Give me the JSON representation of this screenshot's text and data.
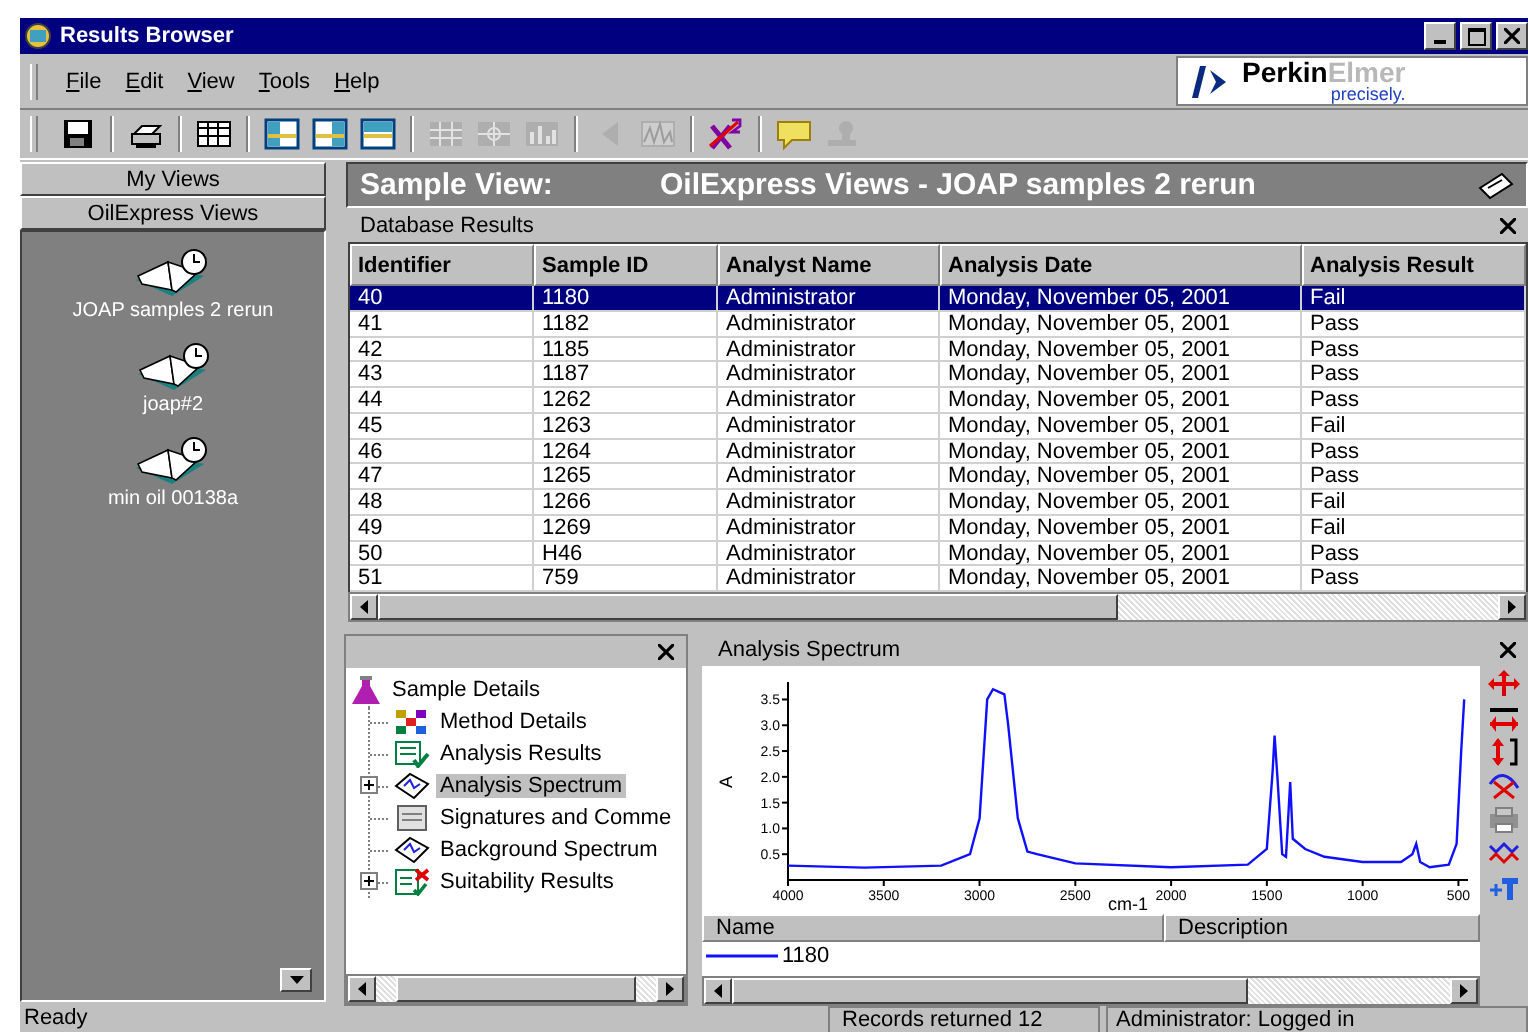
{
  "window": {
    "title": "Results Browser"
  },
  "menu": [
    "File",
    "Edit",
    "View",
    "Tools",
    "Help"
  ],
  "logo": {
    "brand_1": "Perkin",
    "brand_2": "Elmer",
    "tagline": "precisely."
  },
  "toolbar": [
    [
      {
        "kind": "save",
        "disabled": false
      }
    ],
    [
      {
        "kind": "print",
        "disabled": false
      }
    ],
    [
      {
        "kind": "table",
        "disabled": false
      }
    ],
    [
      {
        "kind": "layout-left",
        "disabled": false
      },
      {
        "kind": "layout-right",
        "disabled": false
      },
      {
        "kind": "layout-top",
        "disabled": false
      }
    ],
    [
      {
        "kind": "grid",
        "disabled": true
      },
      {
        "kind": "crosshair",
        "disabled": true
      },
      {
        "kind": "bars",
        "disabled": true
      }
    ],
    [
      {
        "kind": "back",
        "disabled": true
      },
      {
        "kind": "spectrum",
        "disabled": true
      }
    ],
    [
      {
        "kind": "x-squared",
        "disabled": false
      }
    ],
    [
      {
        "kind": "note",
        "disabled": false
      },
      {
        "kind": "stamp",
        "disabled": true
      }
    ]
  ],
  "views": {
    "groups": [
      "My Views",
      "OilExpress Views"
    ],
    "items": [
      "JOAP samples 2 rerun",
      "joap#2",
      "min oil 00138a"
    ]
  },
  "sample_view": {
    "label": "Sample View:",
    "name": "OilExpress Views - JOAP samples 2 rerun"
  },
  "database_results": {
    "title": "Database Results",
    "columns": [
      "Identifier",
      "Sample ID",
      "Analyst Name",
      "Analysis Date",
      "Analysis Result"
    ],
    "rows": [
      {
        "cells": [
          "40",
          "1180",
          "Administrator",
          "Monday, November 05, 2001",
          "Fail"
        ],
        "selected": true
      },
      {
        "cells": [
          "41",
          "1182",
          "Administrator",
          "Monday, November 05, 2001",
          "Pass"
        ],
        "selected": false
      },
      {
        "cells": [
          "42",
          "1185",
          "Administrator",
          "Monday, November 05, 2001",
          "Pass"
        ],
        "selected": false
      },
      {
        "cells": [
          "43",
          "1187",
          "Administrator",
          "Monday, November 05, 2001",
          "Pass"
        ],
        "selected": false
      },
      {
        "cells": [
          "44",
          "1262",
          "Administrator",
          "Monday, November 05, 2001",
          "Pass"
        ],
        "selected": false
      },
      {
        "cells": [
          "45",
          "1263",
          "Administrator",
          "Monday, November 05, 2001",
          "Fail"
        ],
        "selected": false
      },
      {
        "cells": [
          "46",
          "1264",
          "Administrator",
          "Monday, November 05, 2001",
          "Pass"
        ],
        "selected": false
      },
      {
        "cells": [
          "47",
          "1265",
          "Administrator",
          "Monday, November 05, 2001",
          "Pass"
        ],
        "selected": false
      },
      {
        "cells": [
          "48",
          "1266",
          "Administrator",
          "Monday, November 05, 2001",
          "Fail"
        ],
        "selected": false
      },
      {
        "cells": [
          "49",
          "1269",
          "Administrator",
          "Monday, November 05, 2001",
          "Fail"
        ],
        "selected": false
      },
      {
        "cells": [
          "50",
          "H46",
          "Administrator",
          "Monday, November 05, 2001",
          "Pass"
        ],
        "selected": false
      },
      {
        "cells": [
          "51",
          "759",
          "Administrator",
          "Monday, November 05, 2001",
          "Pass"
        ],
        "selected": false
      }
    ]
  },
  "details": {
    "root": "Sample Details",
    "children": [
      {
        "label": "Method Details",
        "kind": "method",
        "expandable": false,
        "selected": false
      },
      {
        "label": "Analysis Results",
        "kind": "results",
        "expandable": false,
        "selected": false
      },
      {
        "label": "Analysis Spectrum",
        "kind": "spectrum",
        "expandable": true,
        "selected": true
      },
      {
        "label": "Signatures and Comme",
        "kind": "signatures",
        "expandable": false,
        "selected": false
      },
      {
        "label": "Background Spectrum",
        "kind": "spectrum",
        "expandable": false,
        "selected": false
      },
      {
        "label": "Suitability Results",
        "kind": "suitability",
        "expandable": true,
        "selected": false
      }
    ]
  },
  "spectrum": {
    "title": "Analysis Spectrum",
    "chart_data": {
      "type": "line",
      "xlabel": "cm-1",
      "ylabel": "A",
      "xlim": [
        4000,
        450
      ],
      "ylim": [
        0,
        3.8
      ],
      "xticks": [
        4000,
        3500,
        3000,
        2500,
        2000,
        1500,
        1000,
        500
      ],
      "yticks": [
        {
          "value": 0.5,
          "label": "0.5"
        },
        {
          "value": 1,
          "label": "1.0"
        },
        {
          "value": 1.5,
          "label": "1.5"
        },
        {
          "value": 2,
          "label": "2.0"
        },
        {
          "value": 2.5,
          "label": "2.5"
        },
        {
          "value": 3,
          "label": "3.0"
        },
        {
          "value": 3.5,
          "label": "3.5"
        }
      ],
      "x": [
        4000,
        3600,
        3200,
        3050,
        3000,
        2960,
        2930,
        2900,
        2870,
        2850,
        2800,
        2750,
        2700,
        2500,
        2000,
        1600,
        1500,
        1470,
        1460,
        1445,
        1420,
        1400,
        1378,
        1365,
        1300,
        1200,
        1000,
        800,
        740,
        720,
        700,
        650,
        550,
        510,
        485,
        470
      ],
      "series": [
        {
          "name": "1180",
          "color": "#1010ff",
          "values": [
            0.28,
            0.24,
            0.28,
            0.5,
            1.2,
            3.5,
            3.7,
            3.65,
            3.6,
            3.0,
            1.2,
            0.55,
            0.5,
            0.32,
            0.25,
            0.3,
            0.6,
            2.1,
            2.8,
            2.0,
            0.5,
            0.45,
            1.9,
            0.8,
            0.6,
            0.45,
            0.35,
            0.35,
            0.5,
            0.7,
            0.35,
            0.25,
            0.3,
            0.7,
            2.5,
            3.5
          ]
        }
      ]
    },
    "legend": {
      "columns": [
        "Name",
        "Description"
      ]
    }
  },
  "status_bar": [
    "Ready",
    "Records returned 12",
    "Administrator: Logged in"
  ]
}
